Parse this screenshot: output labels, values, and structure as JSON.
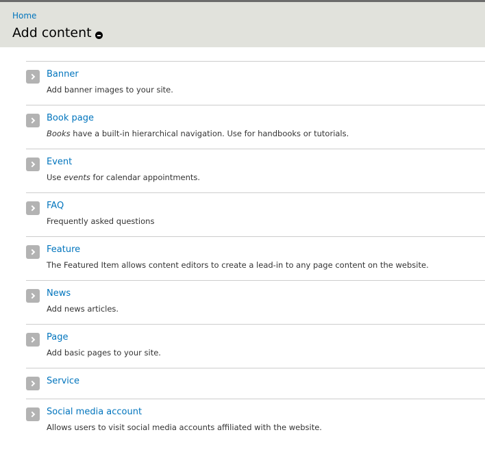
{
  "header": {
    "breadcrumb": "Home",
    "title": "Add content",
    "shortcut_icon": "remove-shortcut-icon"
  },
  "content_types": [
    {
      "label": "Banner",
      "description": "Add banner images to your site."
    },
    {
      "label": "Book page",
      "description_em": "Books",
      "description": " have a built-in hierarchical navigation. Use for handbooks or tutorials."
    },
    {
      "label": "Event",
      "description_pre": "Use ",
      "description_em": "events",
      "description": " for calendar appointments."
    },
    {
      "label": "FAQ",
      "description": "Frequently asked questions"
    },
    {
      "label": "Feature",
      "description": "The Featured Item allows content editors to create a lead-in to any page content on the website."
    },
    {
      "label": "News",
      "description": "Add news articles."
    },
    {
      "label": "Page",
      "description": "Add basic pages to your site."
    },
    {
      "label": "Service",
      "description": ""
    },
    {
      "label": "Social media account",
      "description": "Allows users to visit social media accounts affiliated with the website."
    }
  ],
  "colors": {
    "header_bg": "#e1e2dc",
    "link": "#0074bd",
    "arrow_bg": "#b3b3b3"
  }
}
